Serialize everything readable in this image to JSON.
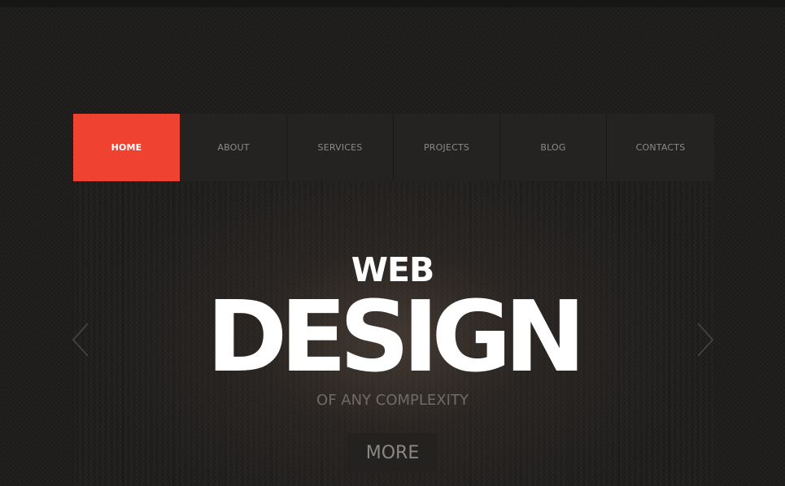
{
  "nav": {
    "items": [
      {
        "label": "HOME",
        "active": true
      },
      {
        "label": "ABOUT",
        "active": false
      },
      {
        "label": "SERVICES",
        "active": false
      },
      {
        "label": "PROJECTS",
        "active": false
      },
      {
        "label": "BLOG",
        "active": false
      },
      {
        "label": "CONTACTS",
        "active": false
      }
    ]
  },
  "hero": {
    "line1": "WEB",
    "line2": "DESIGN",
    "subtitle": "OF ANY COMPLEXITY",
    "button_label": "MORE",
    "prev_icon": "chevron-left-icon",
    "next_icon": "chevron-right-icon"
  },
  "colors": {
    "accent": "#f04231",
    "background": "#1d1c1b",
    "nav_bg": "#242322",
    "text_light": "#ffffff",
    "text_muted": "#8d8a86"
  }
}
